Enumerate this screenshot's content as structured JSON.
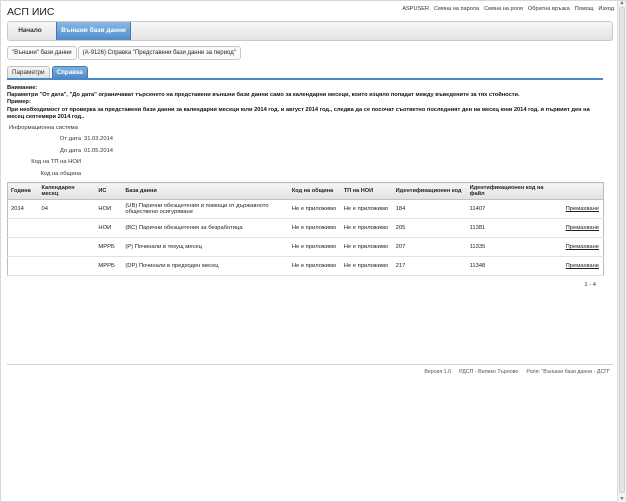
{
  "app": {
    "title": "АСП ИИС"
  },
  "top_links": [
    "ASPUSER",
    "Смяна на парола",
    "Смяна на роля",
    "Обратна връзка",
    "Помощ",
    "Изход"
  ],
  "nav": {
    "home": "Начало",
    "external": "Външни бази данни"
  },
  "breadcrumb": [
    "\"Външни\" бази данни",
    "(А-9126) Справка \"Представени бази данни за период\""
  ],
  "subtabs": {
    "params": "Параметри",
    "report": "Справка"
  },
  "notice": {
    "l1": "Внимание:",
    "l2": "Параметри \"От дата\", \"До дата\" ограничават търсенето на представени външни бази данни само за календарни месеци, които изцяло попадат между въведените за тях стойности.",
    "l3": "Пример:",
    "l4": "При необходимост от проверка за представени бази данни за календарни месеци юли 2014 год. и август 2014 год., следва да се посочат съответно последният ден на месец юни 2014 год. и първият ден на месец септември 2014 год.."
  },
  "form": {
    "section": "Информационна система",
    "from_label": "От дата",
    "from_value": "31.03.2014",
    "to_label": "До дата",
    "to_value": "01.05.2014",
    "tp_label": "Код на ТП на НОИ",
    "mun_label": "Код на община"
  },
  "table": {
    "headers": [
      "Година",
      "Календарен месец",
      "ИС",
      "База данни",
      "Код на община",
      "ТП на НОИ",
      "Идентификационен код",
      "Идентификационен код на файл",
      ""
    ],
    "rows": [
      {
        "year": "2014",
        "month": "04",
        "is": "НОИ",
        "db": "(UB) Парични обезщетения и помощи от държавното обществено осигуряване",
        "mun": "Не е приложимо",
        "tp": "Не е приложимо",
        "id": "184",
        "fid": "11407",
        "action": "Премахване"
      },
      {
        "year": "",
        "month": "",
        "is": "НОИ",
        "db": "(BC) Парични обезщетения за безработица",
        "mun": "Не е приложимо",
        "tp": "Не е приложимо",
        "id": "205",
        "fid": "11381",
        "action": "Премахване"
      },
      {
        "year": "",
        "month": "",
        "is": "МРРБ",
        "db": "(P) Починали в текущ месец",
        "mun": "Не е приложимо",
        "tp": "Не е приложимо",
        "id": "207",
        "fid": "11335",
        "action": "Премахване"
      },
      {
        "year": "",
        "month": "",
        "is": "МРРБ",
        "db": "(DP) Починали в предходен месец",
        "mun": "Не е приложимо",
        "tp": "Не е приложимо",
        "id": "217",
        "fid": "11348",
        "action": "Премахване"
      }
    ]
  },
  "pager": "1 - 4",
  "footer": [
    "Версия 1.0",
    "РДСП - Велико Търново",
    "Роля: \"Външни бази данни - ДСП\""
  ]
}
